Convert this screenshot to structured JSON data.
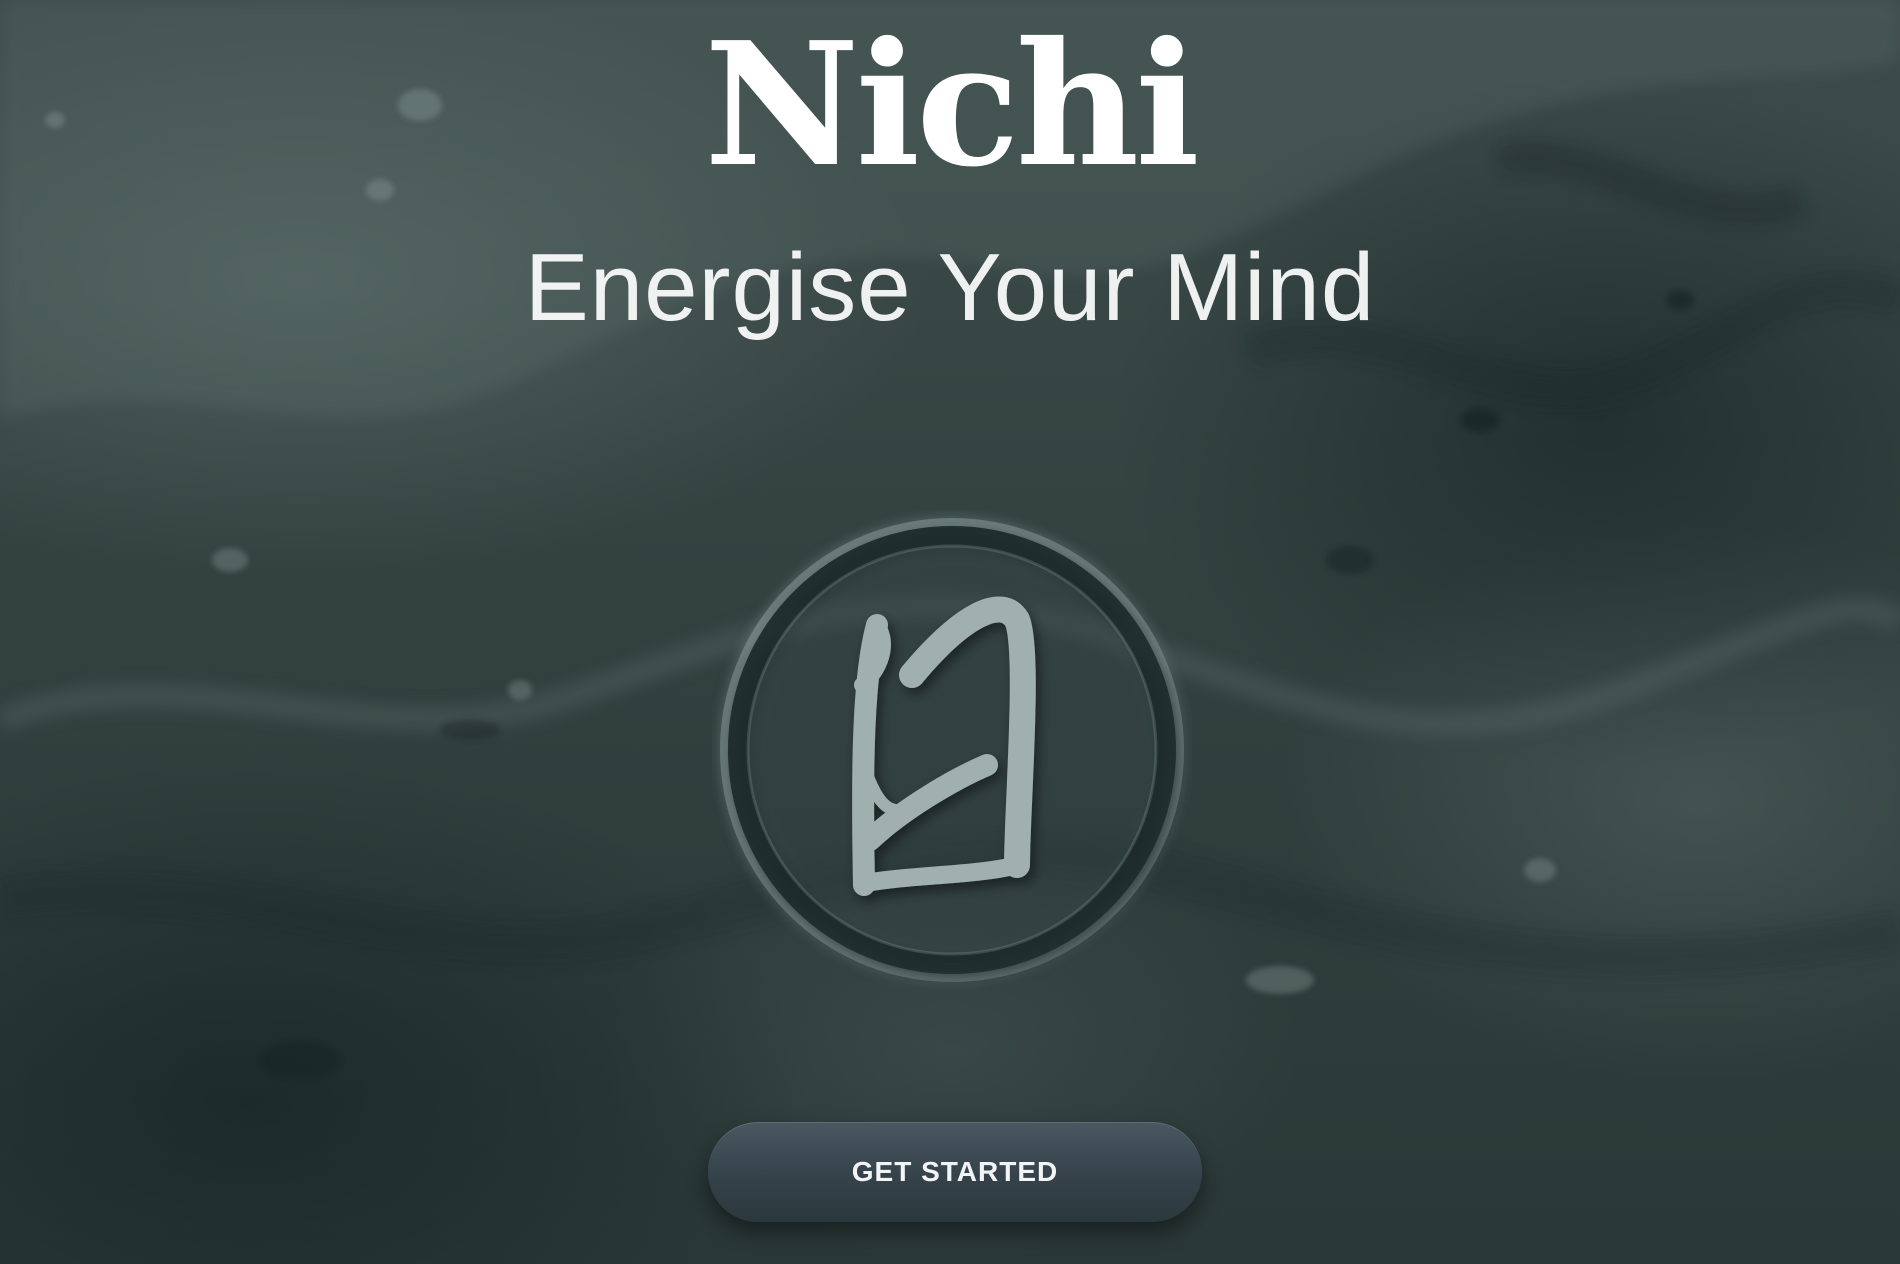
{
  "app": {
    "title": "Nichi",
    "tagline": "Energise Your Mind"
  },
  "logo": {
    "icon": "nichi-logo-icon"
  },
  "cta": {
    "label": "GET STARTED"
  },
  "colors": {
    "background": "#33423f",
    "button": "#3a474f",
    "text": "#ffffff",
    "logo_stroke": "#9fb0ae"
  }
}
